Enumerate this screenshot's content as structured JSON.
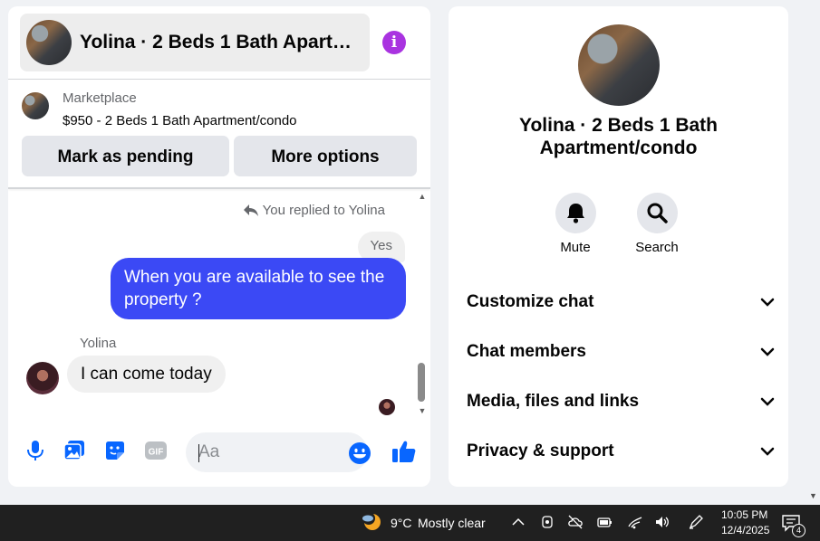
{
  "chat": {
    "title": "Yolina · 2 Beds 1 Bath Apartme…",
    "marketplace_label": "Marketplace",
    "listing_price": "$950 - 2 Beds 1 Bath Apartment/condo",
    "mark_pending_label": "Mark as pending",
    "more_options_label": "More options",
    "replied_note": "You replied to Yolina",
    "quoted_text": "Yes",
    "sent_message": "When you are available to see the property ?",
    "sender_name": "Yolina",
    "received_message": "I can come today",
    "input_placeholder": "Aa"
  },
  "info": {
    "title": "Yolina · 2 Beds 1 Bath Apartment/condo",
    "mute_label": "Mute",
    "search_label": "Search",
    "sections": [
      "Customize chat",
      "Chat members",
      "Media, files and links",
      "Privacy & support"
    ]
  },
  "taskbar": {
    "temperature": "9°C",
    "weather": "Mostly clear",
    "time": "10:05 PM",
    "date": "12/4/2025",
    "notification_count": "4"
  },
  "colors": {
    "accent": "#3b49f5",
    "info_icon": "#a933e0",
    "composer_icons": "#0866ff"
  },
  "icons": [
    "info-icon",
    "reply-icon",
    "microphone-icon",
    "photo-icon",
    "sticker-icon",
    "gif-icon",
    "emoji-icon",
    "like-icon",
    "bell-icon",
    "search-icon",
    "chevron-down-icon",
    "weather-moon-icon",
    "chevron-up-icon",
    "notification-icon"
  ]
}
